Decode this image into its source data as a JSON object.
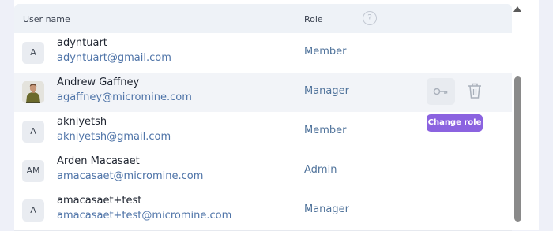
{
  "table": {
    "header": {
      "user_name": "User name",
      "role": "Role",
      "help": "?"
    },
    "rows": [
      {
        "initials": "A",
        "name": "adyntuart",
        "email": "adyntuart@gmail.com",
        "role": "Member"
      },
      {
        "initials": "",
        "name": "Andrew Gaffney",
        "email": "agaffney@micromine.com",
        "role": "Manager"
      },
      {
        "initials": "A",
        "name": "akniyetsh",
        "email": "akniyetsh@gmail.com",
        "role": "Member"
      },
      {
        "initials": "AM",
        "name": "Arden Macasaet",
        "email": "amacasaet@micromine.com",
        "role": "Admin"
      },
      {
        "initials": "A",
        "name": "amacasaet+test",
        "email": "amacasaet+test@micromine.com",
        "role": "Manager"
      }
    ]
  },
  "actions": {
    "change_role_icon": "key-icon",
    "delete_icon": "trash-icon",
    "tooltip": "Change role"
  },
  "colors": {
    "accent": "#8b63e0",
    "email": "#4f74a8",
    "role": "#50739b"
  }
}
